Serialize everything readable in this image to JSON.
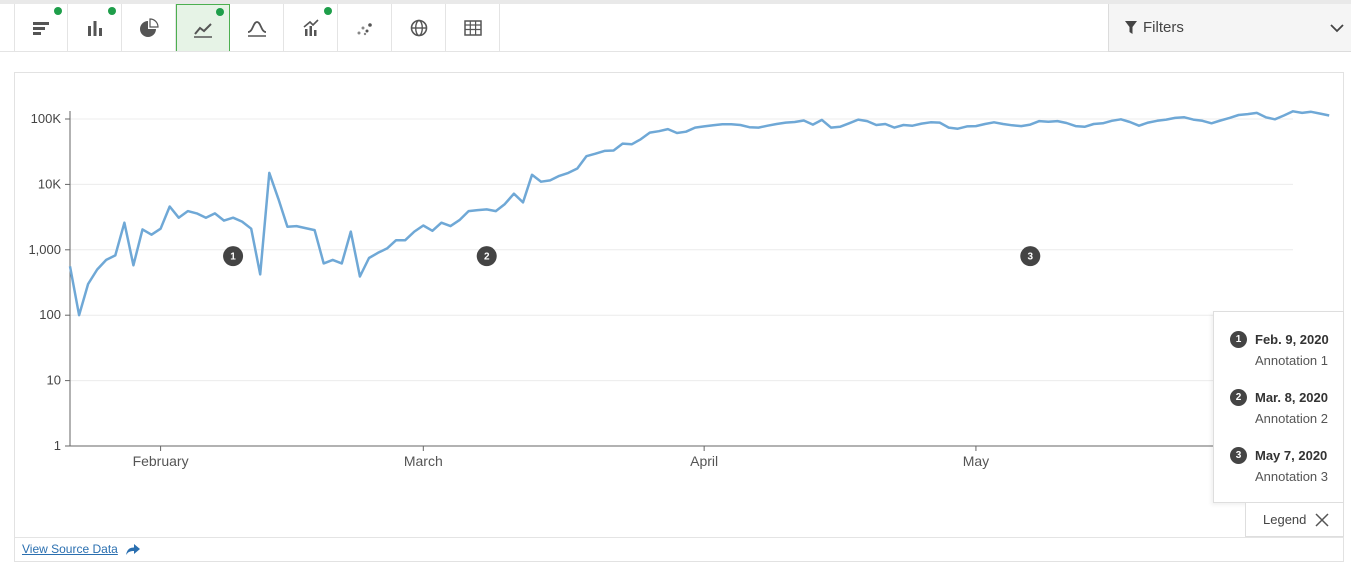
{
  "toolbar": {
    "tools": [
      {
        "icon": "horizontal-bar-chart-icon",
        "active": false,
        "dot": true
      },
      {
        "icon": "bar-chart-icon",
        "active": false,
        "dot": true
      },
      {
        "icon": "pie-chart-icon",
        "active": false,
        "dot": false
      },
      {
        "icon": "line-chart-icon",
        "active": true,
        "dot": true
      },
      {
        "icon": "bell-curve-icon",
        "active": false,
        "dot": false
      },
      {
        "icon": "bar-line-combo-icon",
        "active": false,
        "dot": true
      },
      {
        "icon": "scatter-plot-icon",
        "active": false,
        "dot": false
      },
      {
        "icon": "globe-map-icon",
        "active": false,
        "dot": false
      },
      {
        "icon": "table-icon",
        "active": false,
        "dot": false
      }
    ]
  },
  "filters": {
    "label": "Filters",
    "icon": "funnel-icon",
    "chevron": "chevron-down-icon"
  },
  "legend": {
    "footer_label": "Legend",
    "close_icon": "close-icon",
    "items": [
      {
        "num": "1",
        "date": "Feb. 9, 2020",
        "text": "Annotation 1"
      },
      {
        "num": "2",
        "date": "Mar. 8, 2020",
        "text": "Annotation 2"
      },
      {
        "num": "3",
        "date": "May 7, 2020",
        "text": "Annotation 3"
      }
    ]
  },
  "source_link": {
    "label": "View Source Data",
    "icon": "share-arrow-icon"
  },
  "colors": {
    "line": "#6fa8d6",
    "accent": "#4caf50",
    "dot": "#1e9e4a",
    "badge": "#444444"
  },
  "chart_data": {
    "type": "line",
    "title": "",
    "xlabel": "",
    "ylabel": "",
    "y_scale": "log",
    "ylim": [
      1,
      100000
    ],
    "y_ticks": [
      {
        "value": 1,
        "label": "1"
      },
      {
        "value": 10,
        "label": "10"
      },
      {
        "value": 100,
        "label": "100"
      },
      {
        "value": 1000,
        "label": "1,000"
      },
      {
        "value": 10000,
        "label": "10K"
      },
      {
        "value": 100000,
        "label": "100K"
      }
    ],
    "x_start": "2020-01-22",
    "x_end": "2020-06-05",
    "x_ticks": [
      {
        "date": "2020-02-01",
        "label": "February"
      },
      {
        "date": "2020-03-01",
        "label": "March"
      },
      {
        "date": "2020-04-01",
        "label": "April"
      },
      {
        "date": "2020-05-01",
        "label": "May"
      }
    ],
    "grid": true,
    "legend_position": "right",
    "annotations": [
      {
        "num": "1",
        "date": "2020-02-09",
        "y": 800
      },
      {
        "num": "2",
        "date": "2020-03-08",
        "y": 800
      },
      {
        "num": "3",
        "date": "2020-05-07",
        "y": 800
      }
    ],
    "series": [
      {
        "start_date": "2020-01-22",
        "values": [
          560,
          100,
          300,
          500,
          700,
          820,
          2600,
          580,
          2050,
          1700,
          2100,
          4600,
          3100,
          3900,
          3600,
          3100,
          3600,
          2800,
          3100,
          2700,
          2100,
          420,
          15000,
          6000,
          2250,
          2300,
          2150,
          2000,
          620,
          700,
          620,
          1900,
          390,
          750,
          900,
          1050,
          1400,
          1400,
          1900,
          2350,
          1950,
          2600,
          2300,
          2850,
          3900,
          4050,
          4150,
          3900,
          5000,
          7200,
          5300,
          14000,
          11000,
          11500,
          13500,
          15000,
          17500,
          27000,
          29500,
          32500,
          33000,
          42000,
          41000,
          49000,
          62000,
          65000,
          70000,
          61000,
          64000,
          74000,
          77000,
          80000,
          83000,
          83000,
          81000,
          75000,
          74000,
          79000,
          84000,
          88000,
          90000,
          95000,
          82000,
          97000,
          74000,
          76000,
          86000,
          98000,
          93000,
          81000,
          84000,
          74000,
          81000,
          79000,
          85000,
          89000,
          88000,
          74000,
          71000,
          77000,
          78000,
          84000,
          89000,
          84000,
          80000,
          78000,
          82000,
          93000,
          91000,
          93000,
          87000,
          78000,
          76000,
          84000,
          86000,
          94000,
          99000,
          90000,
          79000,
          88000,
          94000,
          98000,
          104000,
          106000,
          98000,
          94000,
          86000,
          95000,
          104000,
          115000,
          119000,
          124000,
          106000,
          99000,
          113000,
          131000,
          124000,
          129000,
          121000,
          113000
        ]
      }
    ]
  }
}
